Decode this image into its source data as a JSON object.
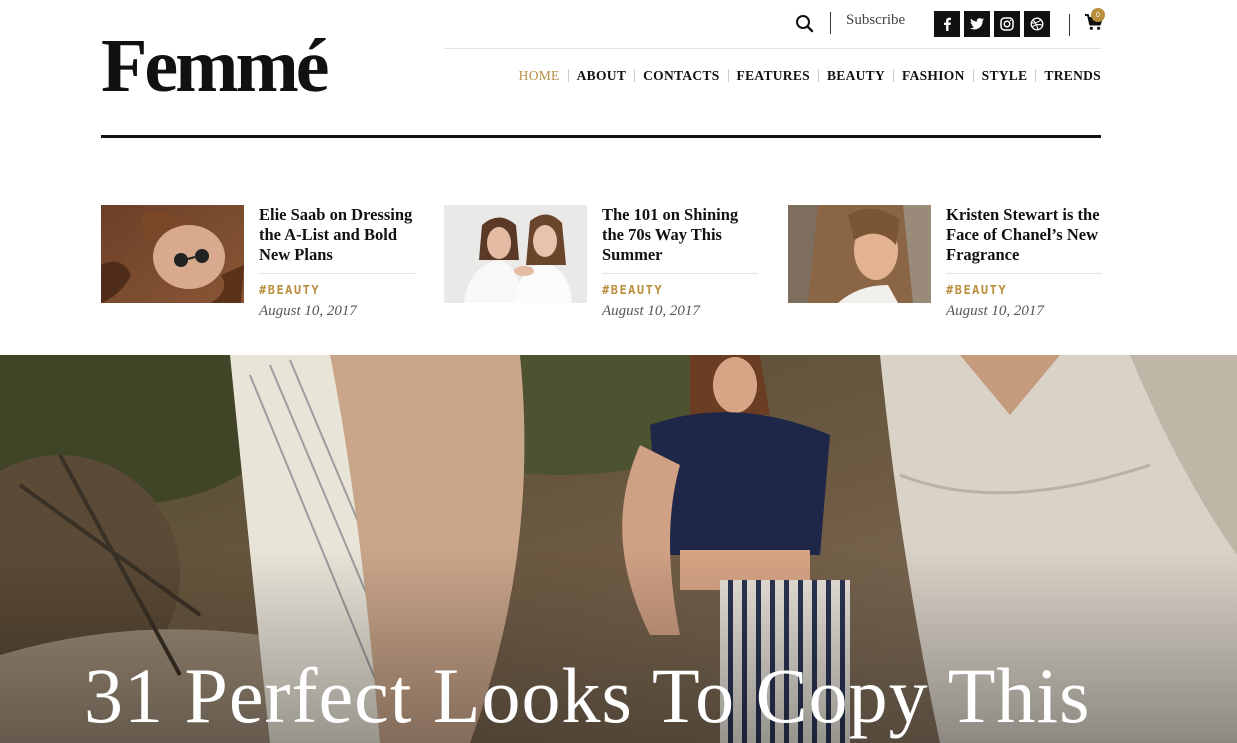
{
  "brand": {
    "logo": "Femmé"
  },
  "topbar": {
    "subscribe_label": "Subscribe",
    "social_icons": [
      "facebook-icon",
      "twitter-icon",
      "instagram-icon",
      "dribbble-icon"
    ],
    "cart_count": "0"
  },
  "nav": {
    "items": [
      {
        "label": "HOME",
        "active": true
      },
      {
        "label": "ABOUT"
      },
      {
        "label": "CONTACTS"
      },
      {
        "label": "FEATURES"
      },
      {
        "label": "BEAUTY"
      },
      {
        "label": "FASHION"
      },
      {
        "label": "STYLE"
      },
      {
        "label": "TRENDS"
      }
    ]
  },
  "featured": [
    {
      "title": "Elie Saab on Dressing the A-List and Bold New Plans",
      "tag": "#BEAUTY",
      "date": "August 10, 2017"
    },
    {
      "title": "The 101 on Shining the 70s Way This Summer",
      "tag": "#BEAUTY",
      "date": "August 10, 2017"
    },
    {
      "title": "Kristen Stewart is the Face of Chanel’s New Fragrance",
      "tag": "#BEAUTY",
      "date": "August 10, 2017"
    }
  ],
  "hero": {
    "title": "31 Perfect Looks To Copy This"
  },
  "colors": {
    "accent": "#b98e3d",
    "text": "#111111",
    "rule": "#111111"
  }
}
